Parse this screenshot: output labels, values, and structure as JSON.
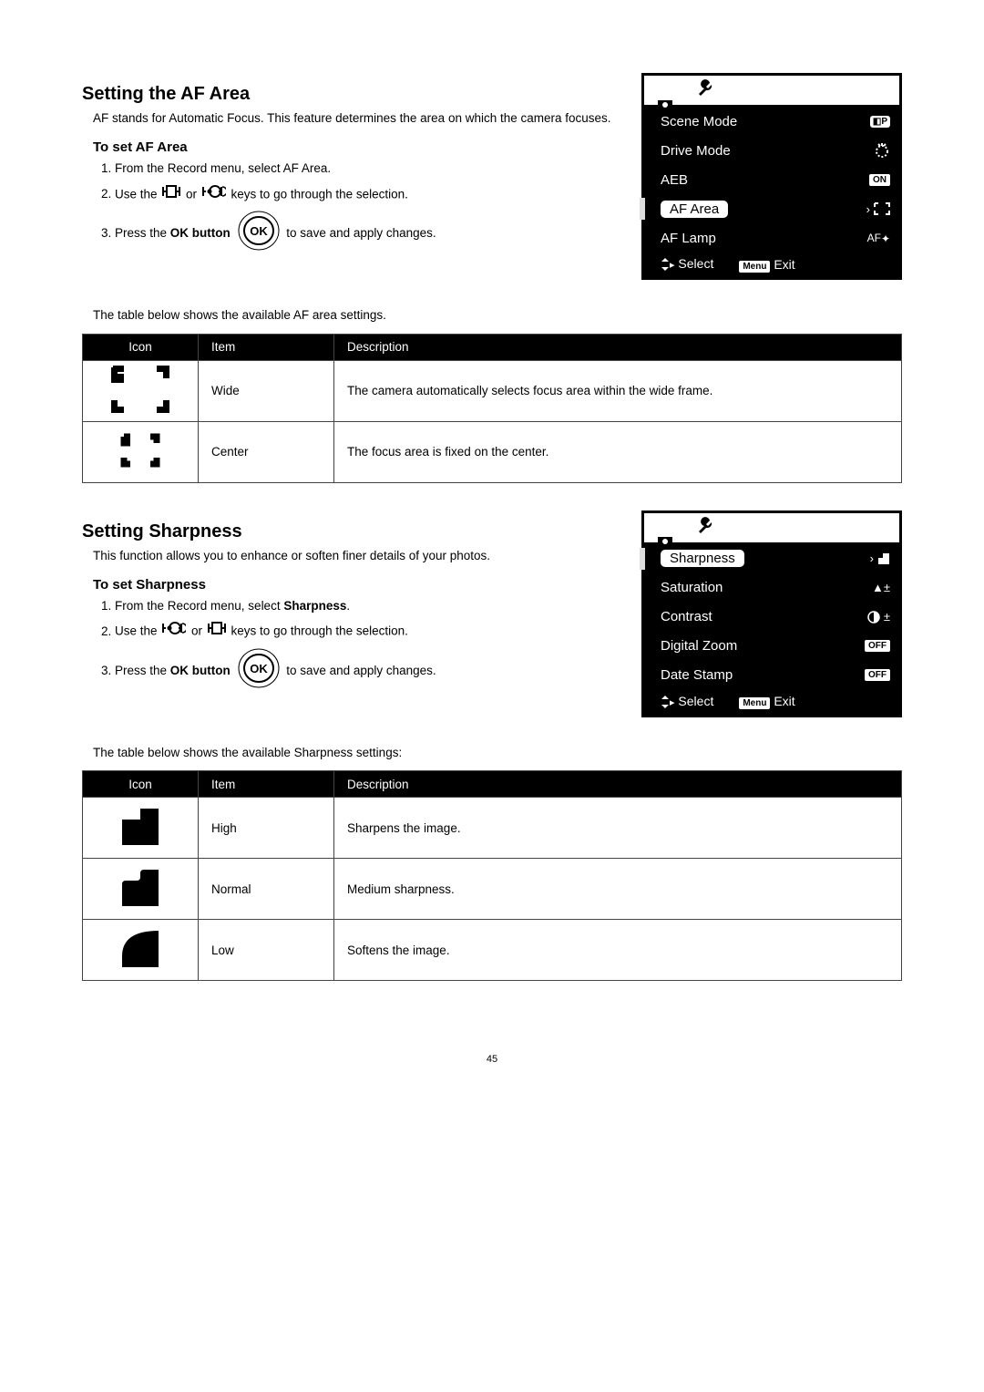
{
  "af": {
    "heading": "Setting the AF Area",
    "intro": "AF stands for Automatic Focus. This feature determines the area on which the camera focuses.",
    "sub": "To set AF Area",
    "step1": "From the Record menu, select AF Area.",
    "step2_a": "Use the ",
    "step2_b": " or ",
    "step2_c": " keys to go through the selection.",
    "step3_a": "Press the ",
    "step3_b": "OK button",
    "step3_c": " to save and apply changes.",
    "caption": "The table below shows the available AF area settings.",
    "cols": {
      "icon": "Icon",
      "item": "Item",
      "desc": "Description"
    },
    "rows": [
      {
        "item": "Wide",
        "desc": "The camera automatically selects focus area within the wide frame."
      },
      {
        "item": "Center",
        "desc": "The focus area is fixed on the center."
      }
    ],
    "lcd": {
      "items": [
        {
          "label": "Scene Mode",
          "value_badge": "P"
        },
        {
          "label": "Drive Mode",
          "value_glyph": "timer"
        },
        {
          "label": "AEB",
          "value_badge": "ON"
        },
        {
          "label": "AF Area",
          "hl": true,
          "value_glyph": "af-wide",
          "chev": true
        },
        {
          "label": "AF Lamp",
          "value_text": "AF"
        }
      ],
      "footer_select": "Select",
      "footer_menu": "Menu",
      "footer_exit": "Exit"
    }
  },
  "sh": {
    "heading": "Setting Sharpness",
    "intro": "This function allows you to enhance or soften finer details of your photos.",
    "sub": "To set Sharpness",
    "step1_a": "From the Record menu, select ",
    "step1_b": "Sharpness",
    "step1_c": ".",
    "step2_a": "Use the ",
    "step2_b": " or ",
    "step2_c": " keys to go through the selection.",
    "step3_a": "Press the ",
    "step3_b": "OK button",
    "step3_c": " to save and apply changes.",
    "caption": "The table below shows the available Sharpness settings:",
    "cols": {
      "icon": "Icon",
      "item": "Item",
      "desc": "Description"
    },
    "rows": [
      {
        "item": "High",
        "desc": "Sharpens the image."
      },
      {
        "item": "Normal",
        "desc": "Medium sharpness."
      },
      {
        "item": "Low",
        "desc": "Softens the image."
      }
    ],
    "lcd": {
      "items": [
        {
          "label": "Sharpness",
          "hl": true,
          "value_glyph": "sharp-high",
          "chev": true
        },
        {
          "label": "Saturation",
          "value_text": "▲±"
        },
        {
          "label": "Contrast",
          "value_glyph": "contrast"
        },
        {
          "label": "Digital Zoom",
          "value_badge": "OFF"
        },
        {
          "label": "Date Stamp",
          "value_badge": "OFF"
        }
      ],
      "footer_select": "Select",
      "footer_menu": "Menu",
      "footer_exit": "Exit"
    }
  },
  "page": "45"
}
